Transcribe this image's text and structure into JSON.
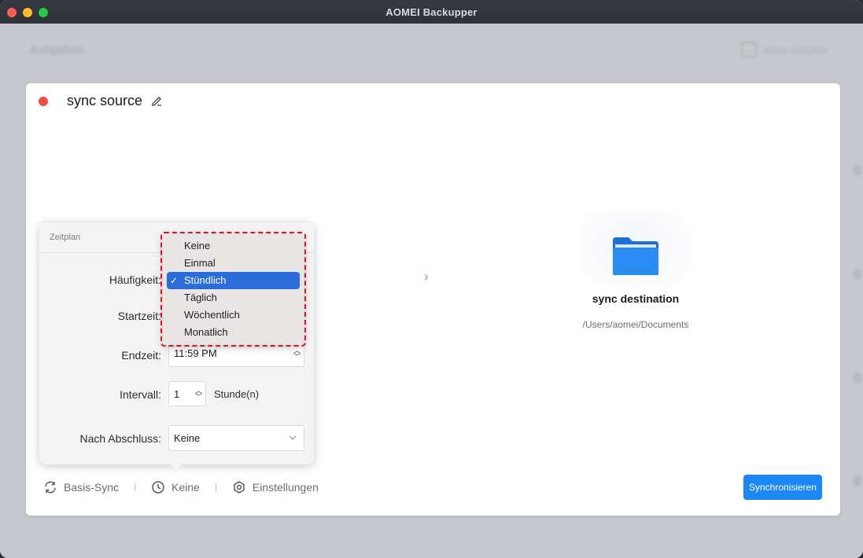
{
  "window": {
    "title": "AOMEI Backupper"
  },
  "background": {
    "title": "Aufgaben",
    "new_task": "Neue Aufgabe"
  },
  "task": {
    "name": "sync source",
    "destination_name": "sync destination",
    "destination_path": "/Users/aomei/Documents"
  },
  "bottom_bar": {
    "sync_mode": "Basis-Sync",
    "schedule": "Keine",
    "settings": "Einstellungen",
    "sync_button": "Synchronisieren"
  },
  "schedule_popover": {
    "title": "Zeitplan",
    "frequency_label": "Häufigkeit:",
    "start_label": "Startzeit:",
    "end_label": "Endzeit:",
    "end_value": "11:59 PM",
    "interval_label": "Intervall:",
    "interval_value": "1",
    "interval_unit": "Stunde(n)",
    "after_label": "Nach Abschluss:",
    "after_value": "Keine"
  },
  "frequency_menu": {
    "items": [
      "Keine",
      "Einmal",
      "Stündlich",
      "Täglich",
      "Wöchentlich",
      "Monatlich"
    ],
    "selected_index": 2,
    "check_mark": "✓"
  },
  "colors": {
    "accent": "#1b87f4",
    "menu_selected": "#2b6cd8",
    "status_dot": "#ee4c45",
    "highlight": "#e5121a"
  }
}
